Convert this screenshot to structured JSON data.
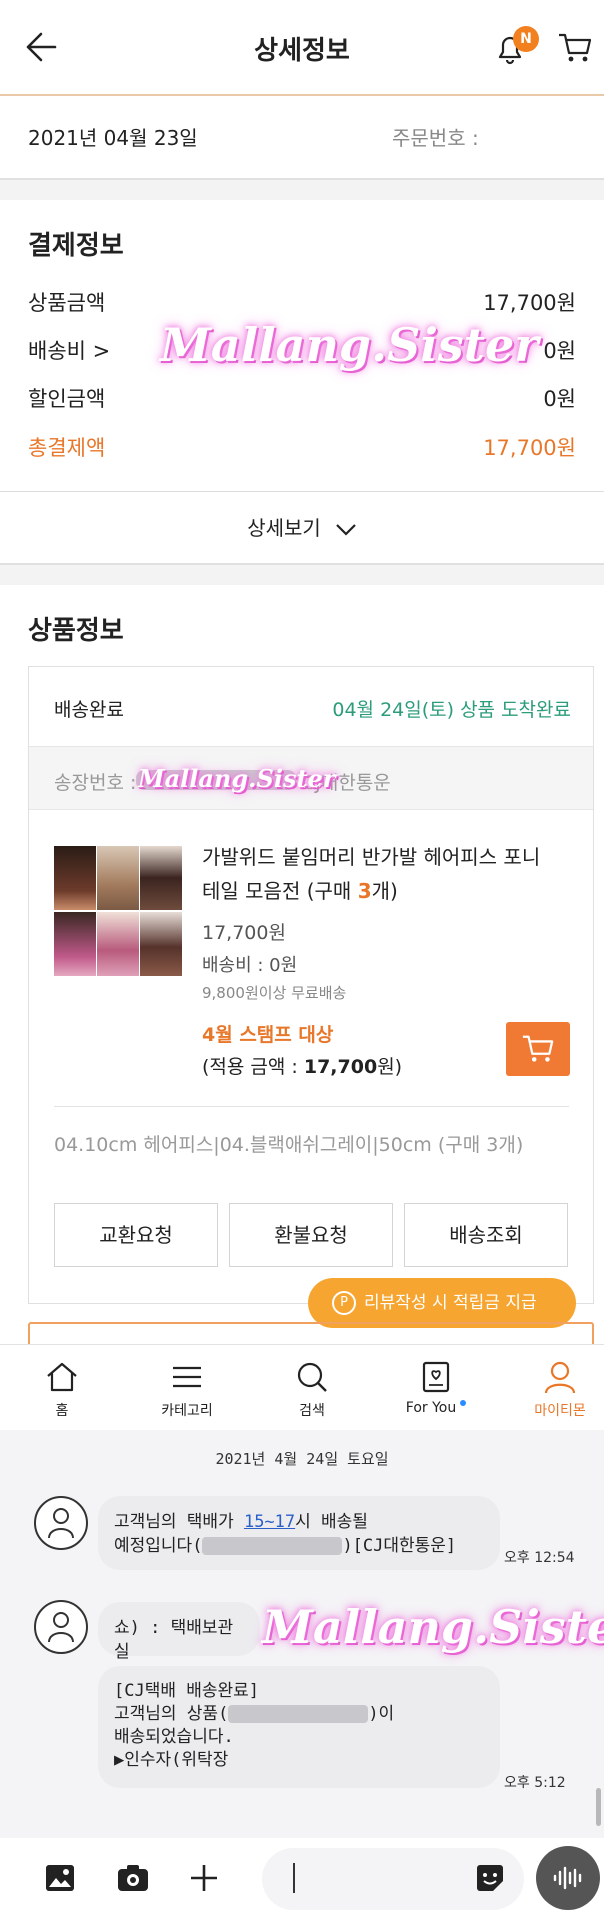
{
  "header": {
    "title": "상세정보",
    "badge": "N"
  },
  "order": {
    "date": "2021년 04월 23일",
    "number_label": "주문번호 :"
  },
  "payment": {
    "title": "결제정보",
    "rows": [
      {
        "label": "상품금액",
        "value": "17,700원"
      },
      {
        "label": "배송비 >",
        "value": "0원"
      },
      {
        "label": "할인금액",
        "value": "0원"
      },
      {
        "label": "총결제액",
        "value": "17,700원"
      }
    ],
    "detail_toggle": "상세보기"
  },
  "product": {
    "title": "상품정보",
    "status": "배송완료",
    "arrival": "04월 24일(토) 상품 도착완료",
    "invoice_label": "송장번호 :",
    "carrier": "CJ대한통운",
    "name_line1": "가발위드 붙임머리 반가발 헤어피스 포니",
    "name_line2_prefix": "테일 모음전 (구매 ",
    "name_count": "3",
    "name_line2_suffix": "개)",
    "price": "17,700원",
    "shipping": "배송비 : 0원",
    "free_ship": "9,800원이상 무료배송",
    "stamp": "4월 스탬프 대상",
    "applied_prefix": "(적용 금액 : ",
    "applied_amount": "17,700",
    "applied_suffix": "원)",
    "option": "04.10cm 헤어피스|04.블랙애쉬그레이|50cm (구매 3개)",
    "buttons": [
      "교환요청",
      "환불요청",
      "배송조회"
    ],
    "review_tip": "리뷰작성 시 적립금 지급",
    "review_tip_icon": "P"
  },
  "bottom_nav": [
    {
      "label": "홈",
      "icon": "home-icon"
    },
    {
      "label": "카테고리",
      "icon": "menu-icon"
    },
    {
      "label": "검색",
      "icon": "search-icon"
    },
    {
      "label": "For You",
      "icon": "for-you-icon"
    },
    {
      "label": "마이티몬",
      "icon": "person-icon"
    }
  ],
  "chat": {
    "date": "2021년 4월 24일 토요일",
    "msg1_line1_a": "고객님의 택배가 ",
    "msg1_link": "15~17",
    "msg1_line1_b": "시 배송될",
    "msg1_line2_a": "예정입니다(",
    "msg1_line2_b": ")[CJ대한통운]",
    "msg1_time": "오후 12:54",
    "sender2": "쇼) : 택배보관실",
    "msg2_line1": "[CJ택배 배송완료]",
    "msg2_line2_a": " 고객님의 상품(",
    "msg2_line2_b": ")이",
    "msg2_line3": "배송되었습니다.",
    "msg2_line4": "▶인수자(위탁장",
    "msg2_time": "오후 5:12"
  },
  "watermark": "Mallang.Sister",
  "colors": {
    "accent": "#e8772a",
    "green": "#2c9c7b",
    "tooltip": "#f7a531"
  }
}
